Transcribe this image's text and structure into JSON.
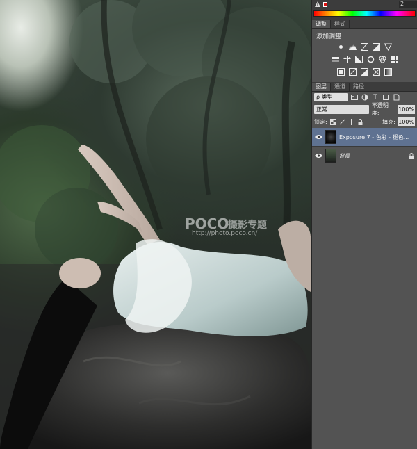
{
  "photo": {
    "watermark_logo": "POCO",
    "watermark_title": "摄影专题",
    "watermark_url": "http://photo.poco.cn/"
  },
  "color_panel": {
    "number_field": "2",
    "swatch_color": "#dd1111"
  },
  "adjustments_panel": {
    "tabs": [
      {
        "label": "调整"
      },
      {
        "label": "样式"
      }
    ],
    "title": "添加调整",
    "row1_icons": [
      "brightness-icon",
      "levels-icon",
      "curves-icon",
      "exposure-icon",
      "vibrance-icon"
    ],
    "row2_icons": [
      "hue-saturation-icon",
      "color-balance-icon",
      "black-white-icon",
      "photo-filter-icon",
      "channel-mixer-icon",
      "color-lookup-icon"
    ],
    "row3_icons": [
      "invert-icon",
      "posterize-icon",
      "threshold-icon",
      "selective-color-icon",
      "gradient-map-icon"
    ]
  },
  "layers_panel": {
    "tabs": [
      {
        "label": "图层"
      },
      {
        "label": "通道"
      },
      {
        "label": "路径"
      }
    ],
    "filter_kind": "ρ 类型",
    "blend_mode": "正常",
    "opacity_label": "不透明度:",
    "opacity_value": "100%",
    "lock_label": "锁定:",
    "fill_label": "填充:",
    "fill_value": "100%",
    "layers": [
      {
        "name": "Exposure 7 - 色彩 - 褪色...",
        "selected": true
      },
      {
        "name": "背景",
        "selected": false
      }
    ],
    "selected_color": "#5f7291"
  }
}
